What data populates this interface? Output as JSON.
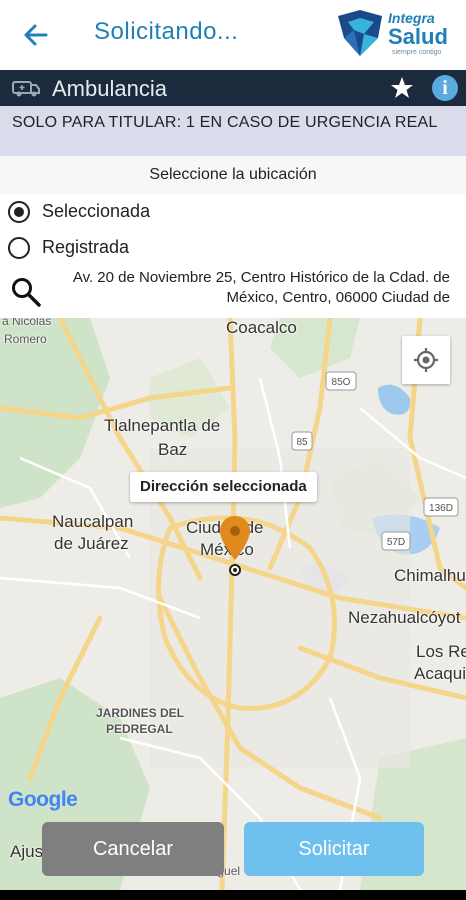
{
  "appbar": {
    "title": "Solicitando...",
    "logo_line1": "Integra",
    "logo_line2": "Salud",
    "logo_tagline": "siempre contigo",
    "colors": {
      "primary": "#1f7fb6",
      "logo_dark": "#1b4a8a",
      "logo_light": "#38b3d9"
    }
  },
  "service_bar": {
    "title": "Ambulancia",
    "icons": [
      "ambulance-icon",
      "star-icon",
      "info-icon"
    ],
    "info_glyph": "i",
    "background": "#1b2a3c"
  },
  "notice": {
    "text": "SOLO PARA TITULAR: 1 EN CASO DE URGENCIA REAL"
  },
  "location": {
    "title": "Seleccione la ubicación",
    "options": [
      {
        "label": "Seleccionada",
        "selected": true
      },
      {
        "label": "Registrada",
        "selected": false
      }
    ],
    "address": "Av. 20 de Noviembre 25, Centro Histórico de la Cdad. de México, Centro, 06000 Ciudad de"
  },
  "map": {
    "tooltip": "Dirección seleccionada",
    "attribution": "Google",
    "labels": {
      "coacalco": "Coacalco",
      "tlalnepantla1": "Tlalnepantla de",
      "tlalnepantla2": "Baz",
      "naucalpan1": "Naucalpan",
      "naucalpan2": "de Juárez",
      "cdmx1": "Ciudad de",
      "cdmx2": "México",
      "chimalhu": "Chimalhu",
      "neza": "Nezahualcóyot",
      "losre": "Los Re",
      "acaqui": "Acaqui",
      "nicolas": "a Nicolás",
      "romero": "Romero",
      "pedregal1": "JARDINES DEL",
      "pedregal2": "PEDREGAL",
      "ajus": "Ajus",
      "sanmiguel": "San Miguel",
      "shield_85o": "85O",
      "shield_85": "85",
      "shield_136d": "136D",
      "shield_57d": "57D"
    },
    "pin_color": "#e08a1e"
  },
  "actions": {
    "cancel": "Cancelar",
    "submit": "Solicitar"
  }
}
